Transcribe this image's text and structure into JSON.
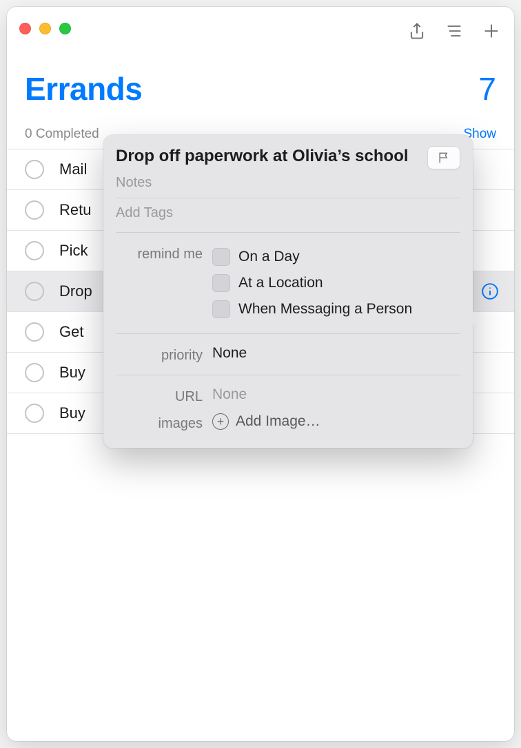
{
  "colors": {
    "accent": "#007aff"
  },
  "list": {
    "title": "Errands",
    "count": "7",
    "completed_text": "0 Completed",
    "show_label": "Show"
  },
  "todos": [
    {
      "label": "Mail"
    },
    {
      "label": "Retu"
    },
    {
      "label": "Pick"
    },
    {
      "label": "Drop",
      "selected": true
    },
    {
      "label": "Get "
    },
    {
      "label": "Buy"
    },
    {
      "label": "Buy"
    }
  ],
  "inspector": {
    "title": "Drop off paperwork at Olivia’s school",
    "notes_placeholder": "Notes",
    "tags_placeholder": "Add Tags",
    "remind_label": "remind me",
    "remind_options": {
      "day": "On a Day",
      "location": "At a Location",
      "messaging": "When Messaging a Person"
    },
    "priority_label": "priority",
    "priority_value": "None",
    "url_label": "URL",
    "url_value": "None",
    "images_label": "images",
    "add_image_label": "Add Image…"
  }
}
